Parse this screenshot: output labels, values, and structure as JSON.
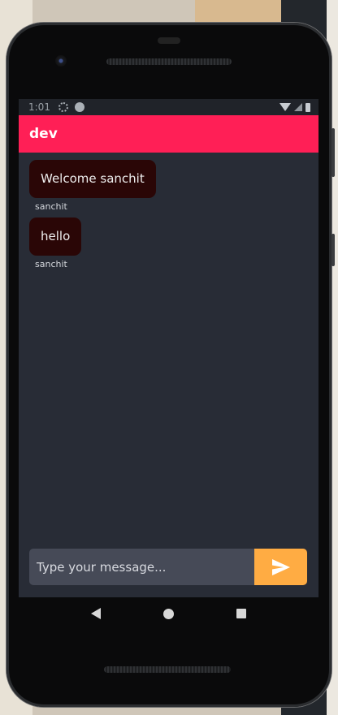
{
  "status_bar": {
    "time": "1:01"
  },
  "app_bar": {
    "title": "dev"
  },
  "messages": [
    {
      "text": "Welcome sanchit",
      "sender": "sanchit"
    },
    {
      "text": "hello",
      "sender": "sanchit"
    }
  ],
  "composer": {
    "placeholder": "Type your message...",
    "value": ""
  },
  "icons": {
    "status": [
      "settings-icon",
      "app-icon",
      "wifi-icon",
      "signal-icon",
      "battery-icon"
    ],
    "send": "send-icon",
    "nav": [
      "back-icon",
      "home-icon",
      "recents-icon"
    ]
  },
  "colors": {
    "app_bar": "#ff1f56",
    "screen_bg": "#282c36",
    "bubble": "#2a0606",
    "input_bg": "#464a57",
    "send_button": "#ffac43"
  }
}
